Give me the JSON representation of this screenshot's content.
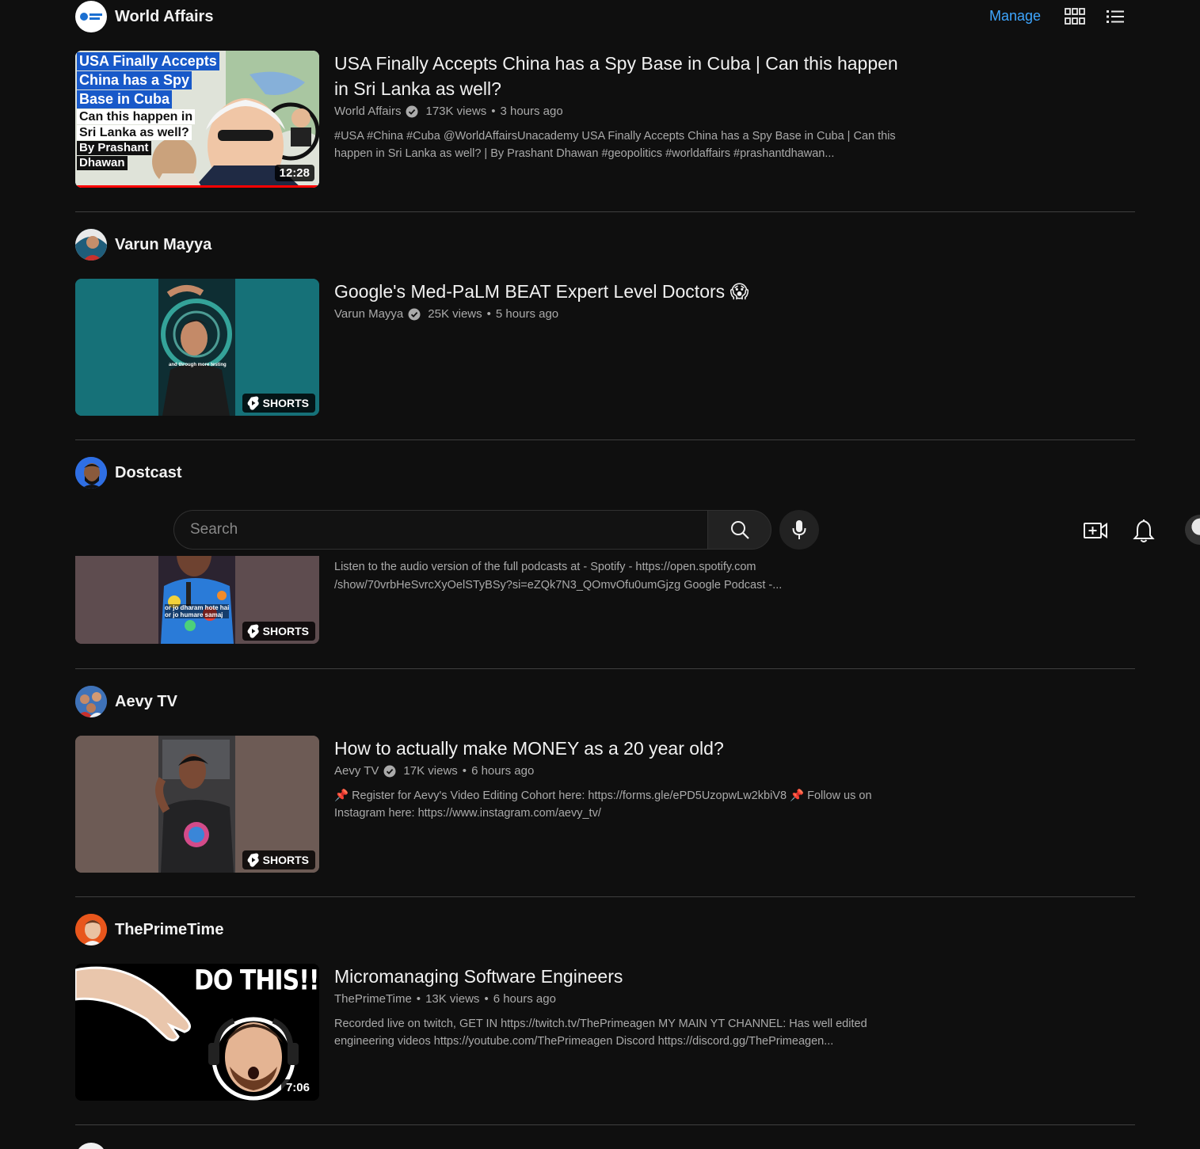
{
  "header": {
    "channel_name": "World Affairs",
    "manage_label": "Manage"
  },
  "search": {
    "placeholder": "Search"
  },
  "sections": [
    {
      "channel": "World Affairs",
      "title": "USA Finally Accepts China has a Spy Base in Cuba | Can this happen in Sri Lanka as well?",
      "channel_meta": "World Affairs",
      "views": "173K views",
      "age": "3 hours ago",
      "description": "#USA #China #Cuba @WorldAffairsUnacademy USA Finally Accepts China has a Spy Base in Cuba | Can this happen in Sri Lanka as well? | By Prashant Dhawan #geopolitics #worldaffairs #prashantdhawan...",
      "duration": "12:28",
      "thumb_text": [
        "USA Finally Accepts",
        "China has a Spy",
        "Base in Cuba",
        "Can this happen in",
        "Sri Lanka as well?",
        "By Prashant",
        "Dhawan"
      ],
      "progress_fraction": 1.0
    },
    {
      "channel": "Varun Mayya",
      "title": "Google's Med-PaLM BEAT Expert Level Doctors 😱",
      "channel_meta": "Varun Mayya",
      "views": "25K views",
      "age": "5 hours ago",
      "description": "",
      "badge": "SHORTS",
      "caption": "and through more testing"
    },
    {
      "channel": "Dostcast",
      "title": "",
      "description": "Listen to the audio version of the full podcasts at - Spotify - https://open.spotify.com /show/70vrbHeSvrcXyOelSTyBSy?si=eZQk7N3_QOmvOfu0umGjzg Google Podcast -...",
      "badge": "SHORTS",
      "caption_line1": "or jo dharam hote hai",
      "caption_line2": "or jo humare samaj"
    },
    {
      "channel": "Aevy TV",
      "title": "How to actually make MONEY as a 20 year old?",
      "channel_meta": "Aevy TV",
      "views": "17K views",
      "age": "6 hours ago",
      "description": "📌 Register for Aevy's Video Editing Cohort here: https://forms.gle/ePD5UzopwLw2kbiV8 📌 Follow us on Instagram here: https://www.instagram.com/aevy_tv/",
      "badge": "SHORTS"
    },
    {
      "channel": "ThePrimeTime",
      "title": "Micromanaging Software Engineers",
      "channel_meta": "ThePrimeTime",
      "views": "13K views",
      "age": "6 hours ago",
      "description": "Recorded live on twitch, GET IN https://twitch.tv/ThePrimeagen MY MAIN YT CHANNEL: Has well edited engineering videos https://youtube.com/ThePrimeagen Discord https://discord.gg/ThePrimeagen...",
      "duration": "7:06",
      "thumb_text": "DO THIS!!"
    }
  ],
  "colors": {
    "background": "#0f0f0f",
    "accent": "#3ea6ff",
    "secondary_text": "#aaaaaa",
    "divider": "#3f3f3f"
  }
}
